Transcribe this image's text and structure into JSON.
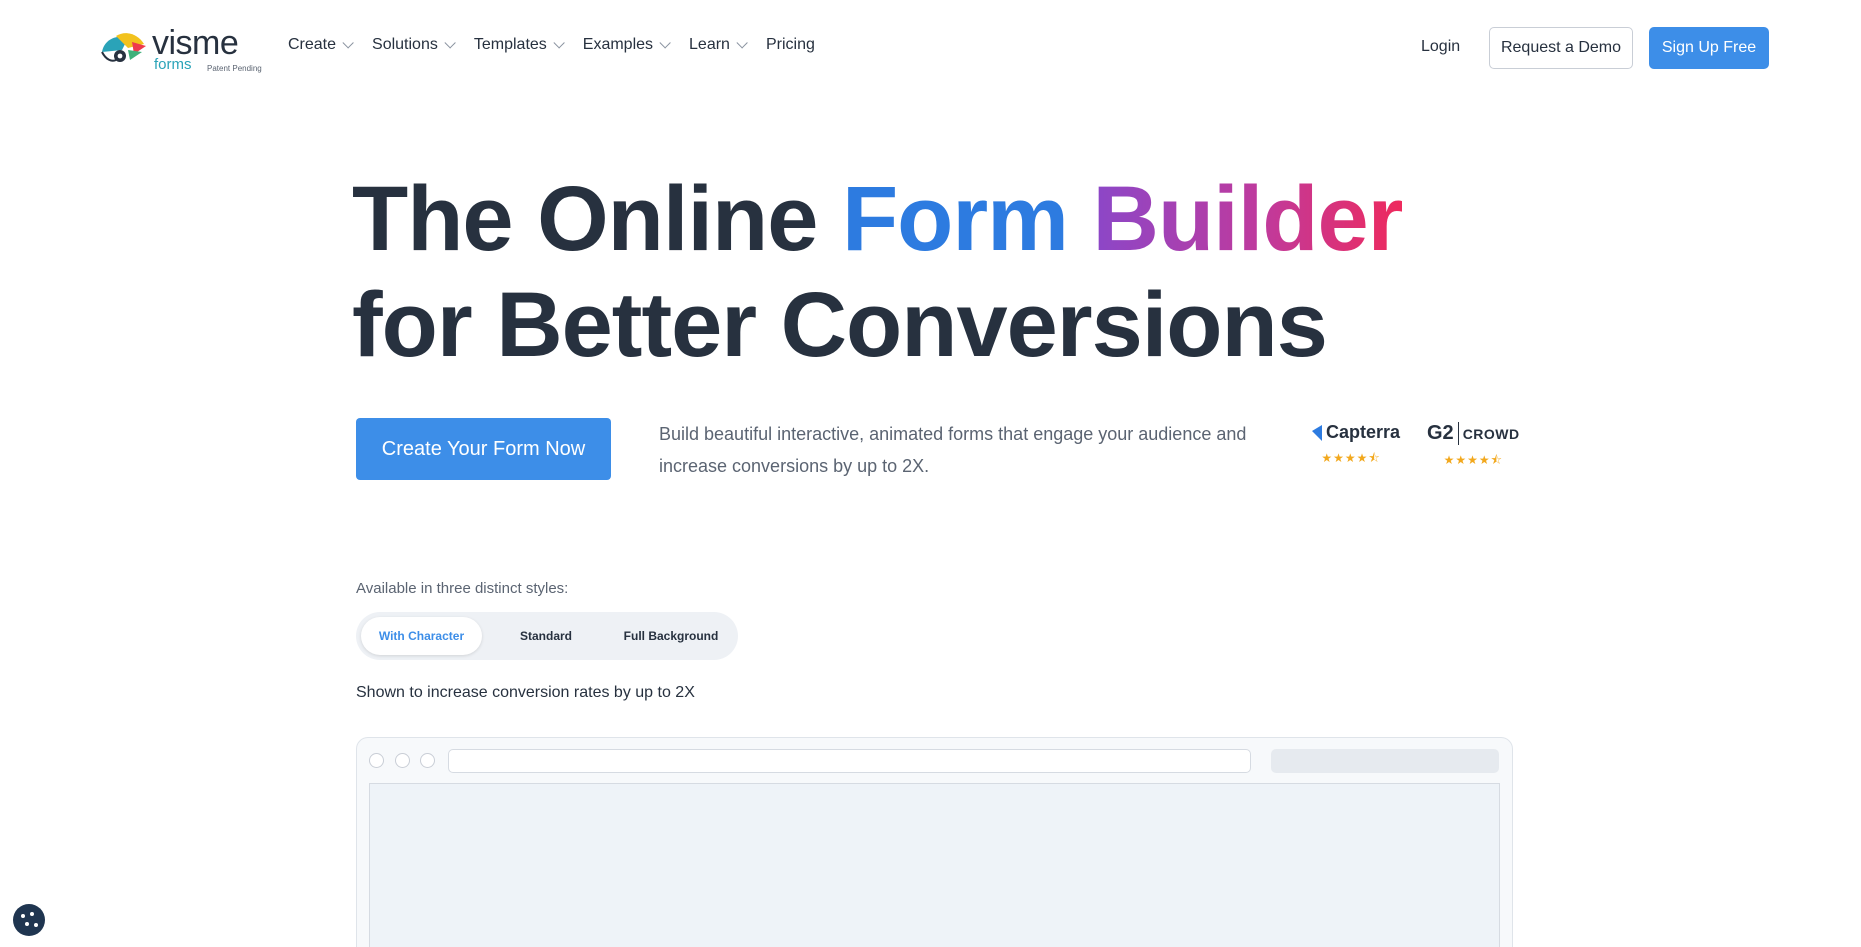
{
  "brand": {
    "name": "visme",
    "product": "forms",
    "badge": "Patent Pending"
  },
  "nav": {
    "items": [
      {
        "label": "Create",
        "dropdown": true
      },
      {
        "label": "Solutions",
        "dropdown": true
      },
      {
        "label": "Templates",
        "dropdown": true
      },
      {
        "label": "Examples",
        "dropdown": true
      },
      {
        "label": "Learn",
        "dropdown": true
      },
      {
        "label": "Pricing",
        "dropdown": false
      }
    ],
    "login": "Login",
    "demo": "Request a Demo",
    "signup": "Sign Up Free"
  },
  "hero": {
    "title_part1": "The Online ",
    "title_form": "Form",
    "title_builder": "Builder",
    "title_line2": "for Better Conversions",
    "cta": "Create Your Form Now",
    "subtext": "Build beautiful interactive, animated forms that engage your audience and increase conversions by up to 2X."
  },
  "ratings": [
    {
      "name": "Capterra",
      "stars": "★★★★⯪"
    },
    {
      "name": "CROWD",
      "prefix": "G2",
      "stars": "★★★★⯪"
    }
  ],
  "styles": {
    "label": "Available in three distinct styles:",
    "options": [
      "With Character",
      "Standard",
      "Full Background"
    ],
    "active": "With Character",
    "note": "Shown to increase conversion rates by up to 2X"
  },
  "colors": {
    "accent": "#3d8ee8",
    "text": "#27313f",
    "gradient": [
      "#8b47c8",
      "#c03a9c",
      "#ee2a5d"
    ]
  },
  "icons": {
    "logo": "chameleon-logo-icon",
    "cookie": "cookie-icon"
  }
}
